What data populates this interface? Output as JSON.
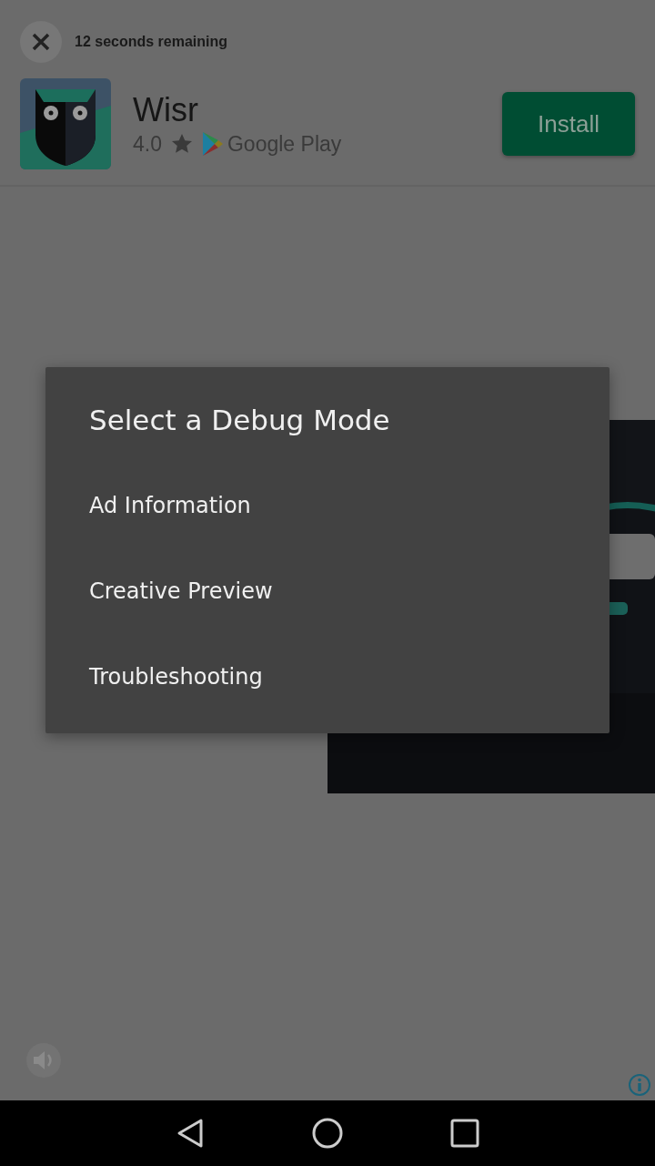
{
  "countdown": {
    "text": "12 seconds remaining"
  },
  "app": {
    "name": "Wisr",
    "rating": "4.0",
    "store": "Google Play",
    "install_button": "Install"
  },
  "dialog": {
    "title": "Select a Debug Mode",
    "items": [
      "Ad Information",
      "Creative Preview",
      "Troubleshooting"
    ]
  }
}
